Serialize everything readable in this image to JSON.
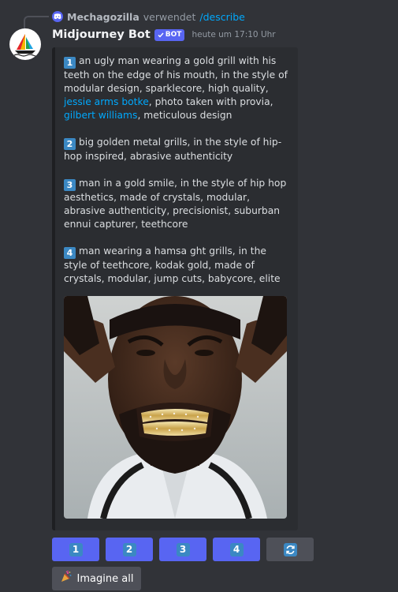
{
  "reply": {
    "user": "Mechagozilla",
    "verb": "verwendet",
    "command": "/describe"
  },
  "message": {
    "author": "Midjourney Bot",
    "badge": "BOT",
    "timestamp": "heute um 17:10 Uhr"
  },
  "prompts": [
    {
      "num": "1",
      "segments": [
        {
          "text": "an ugly man wearing a gold grill with his teeth on the edge of his mouth, in the style of modular design, sparklecore, high quality, ",
          "link": false
        },
        {
          "text": "jessie arms botke",
          "link": true
        },
        {
          "text": ", photo taken with provia, ",
          "link": false
        },
        {
          "text": "gilbert williams",
          "link": true
        },
        {
          "text": ", meticulous design",
          "link": false
        }
      ]
    },
    {
      "num": "2",
      "segments": [
        {
          "text": "big golden metal grills, in the style of hip-hop inspired, abrasive authenticity",
          "link": false
        }
      ]
    },
    {
      "num": "3",
      "segments": [
        {
          "text": "man in a gold smile, in the style of hip hop aesthetics, made of crystals, modular, abrasive authenticity, precisionist, suburban ennui capturer, teethcore",
          "link": false
        }
      ]
    },
    {
      "num": "4",
      "segments": [
        {
          "text": "man wearing a hamsa ght grills, in the style of teethcore, kodak gold, made of crystals, modular, jump cuts, babycore, elite",
          "link": false
        }
      ]
    }
  ],
  "buttons": [
    "1",
    "2",
    "3",
    "4"
  ],
  "refresh_icon": "refresh-icon",
  "imagine": {
    "label": "Imagine all",
    "icon": "party-popper-icon"
  },
  "colors": {
    "background": "#313338",
    "embed": "#2b2d31",
    "blurple": "#5865f2",
    "link": "#00a8fc",
    "keycap": "#3b88c3"
  }
}
